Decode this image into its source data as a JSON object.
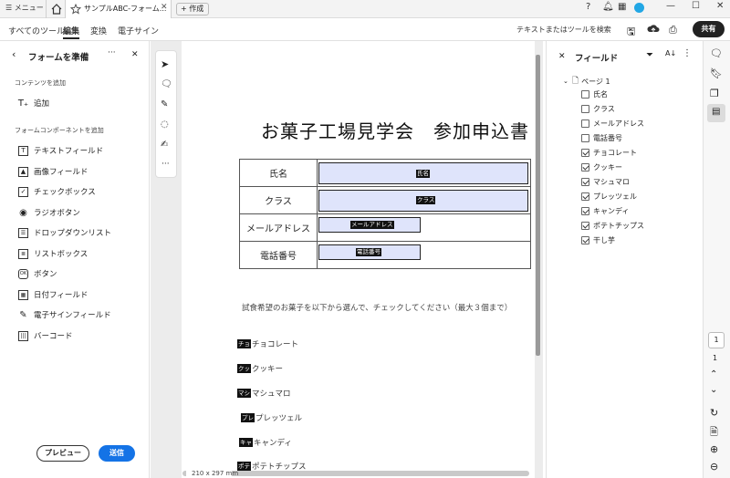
{
  "tabbar": {
    "menu_label": "メニュー",
    "doc_tab_title": "サンプルABC-フォーム...",
    "new_tab_label": "作成"
  },
  "toolbar": {
    "tabs": [
      "すべてのツール",
      "編集",
      "変換",
      "電子サイン"
    ],
    "active_tab": "編集",
    "search_label": "テキストまたはツールを検索",
    "share_label": "共有"
  },
  "left_panel": {
    "title": "フォームを準備",
    "section_add": "コンテンツを追加",
    "add_label": "追加",
    "section_components": "フォームコンポーネントを追加",
    "components": [
      "テキストフィールド",
      "画像フィールド",
      "チェックボックス",
      "ラジオボタン",
      "ドロップダウンリスト",
      "リストボックス",
      "ボタン",
      "日付フィールド",
      "電子サインフィールド",
      "バーコード"
    ],
    "preview_label": "プレビュー",
    "send_label": "送信"
  },
  "document": {
    "title": "お菓子工場見学会　参加申込書",
    "rows": [
      {
        "label": "氏名",
        "field": "氏名"
      },
      {
        "label": "クラス",
        "field": "クラス"
      },
      {
        "label": "メールアドレス",
        "field": "メールアドレス"
      },
      {
        "label": "電話番号",
        "field": "電話番号"
      }
    ],
    "instruction": "試食希望のお菓子を以下から選んで、チェックしてください（最大３個まで）",
    "options": [
      {
        "tag": "チョ",
        "text": "チョコレート"
      },
      {
        "tag": "クッ",
        "text": "クッキー"
      },
      {
        "tag": "マシ",
        "text": "マシュマロ"
      },
      {
        "tag": "プレ",
        "text": "プレッツェル"
      },
      {
        "tag": "キャ",
        "text": "キャンディ"
      },
      {
        "tag": "ポテ",
        "text": "ポテトチップス"
      }
    ],
    "page_size": "210 x 297 mm"
  },
  "right_panel": {
    "title": "フィールド",
    "page_label": "ページ 1",
    "fields": [
      {
        "type": "text",
        "name": "氏名"
      },
      {
        "type": "text",
        "name": "クラス"
      },
      {
        "type": "text",
        "name": "メールアドレス"
      },
      {
        "type": "text",
        "name": "電話番号"
      },
      {
        "type": "check",
        "name": "チョコレート"
      },
      {
        "type": "check",
        "name": "クッキー"
      },
      {
        "type": "check",
        "name": "マシュマロ"
      },
      {
        "type": "check",
        "name": "プレッツェル"
      },
      {
        "type": "check",
        "name": "キャンディ"
      },
      {
        "type": "check",
        "name": "ポテトチップス"
      },
      {
        "type": "check",
        "name": "干し芋"
      }
    ]
  },
  "rail": {
    "current_page": "1",
    "total_pages": "1"
  },
  "colors": {
    "accent": "#1473e6",
    "field_fill": "#dfe4fb"
  }
}
